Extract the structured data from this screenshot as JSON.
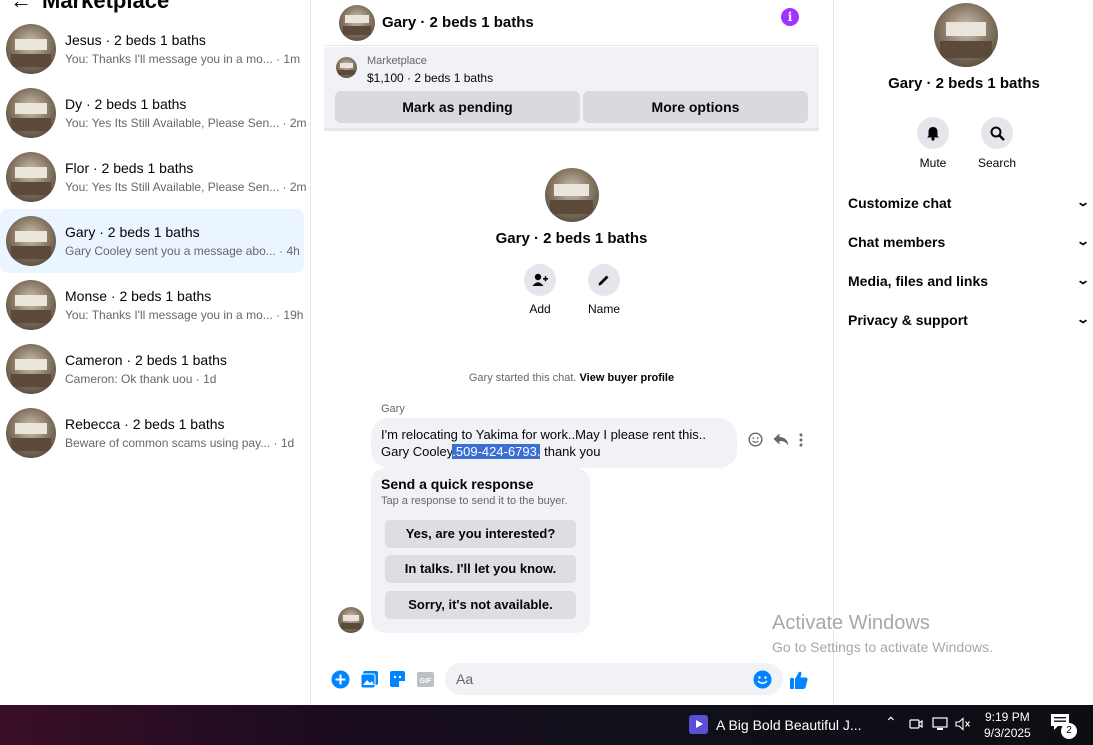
{
  "left": {
    "title": "Marketplace",
    "conversations": [
      {
        "name": "Jesus · 2 beds 1 baths",
        "preview": "You: Thanks I'll message you in a mo... · 1m"
      },
      {
        "name": "Dy · 2 beds 1 baths",
        "preview": "You: Yes Its Still Available, Please Sen... · 2m"
      },
      {
        "name": "Flor · 2 beds 1 baths",
        "preview": "You: Yes Its Still Available, Please Sen... · 2m"
      },
      {
        "name": "Gary · 2 beds 1 baths",
        "preview": "Gary Cooley sent you a message abo... · 4h"
      },
      {
        "name": "Monse · 2 beds 1 baths",
        "preview": "You: Thanks I'll message you in a mo... · 19h"
      },
      {
        "name": "Cameron · 2 beds 1 baths",
        "preview": "Cameron: Ok thank uou · 1d"
      },
      {
        "name": "Rebecca · 2 beds 1 baths",
        "preview": "Beware of common scams using pay... · 1d"
      }
    ]
  },
  "chat": {
    "title": "Gary · 2 beds 1 baths",
    "listing_label": "Marketplace",
    "listing_price": "$1,100 · 2 beds 1 baths",
    "mark_pending": "Mark as pending",
    "more_options": "More options",
    "center_name": "Gary · 2 beds 1 baths",
    "add_label": "Add",
    "name_label": "Name",
    "started_text": "Gary started this chat.",
    "buyer_profile": "View buyer profile",
    "sender": "Gary",
    "message_part1": "I'm relocating to Yakima for work..May I please rent this.. Gary Cooley",
    "message_highlight": ".509-424-6793.",
    "message_part2": " thank you",
    "quick_title": "Send a quick response",
    "quick_sub": "Tap a response to send it to the buyer.",
    "quick_responses": [
      "Yes, are you interested?",
      "In talks. I'll let you know.",
      "Sorry, it's not available."
    ],
    "input_placeholder": "Aa"
  },
  "right": {
    "name": "Gary · 2 beds 1 baths",
    "mute": "Mute",
    "search": "Search",
    "sections": [
      "Customize chat",
      "Chat members",
      "Media, files and links",
      "Privacy & support"
    ]
  },
  "watermark": {
    "line1": "Activate Windows",
    "line2": "Go to Settings to activate Windows."
  },
  "taskbar": {
    "app_title": "A Big Bold Beautiful J...",
    "time": "9:19 PM",
    "date": "9/3/2025",
    "notification_count": "2"
  },
  "colors": {
    "accent": "#0084ff",
    "active_row": "#ebf5ff",
    "info": "#a033ff"
  }
}
